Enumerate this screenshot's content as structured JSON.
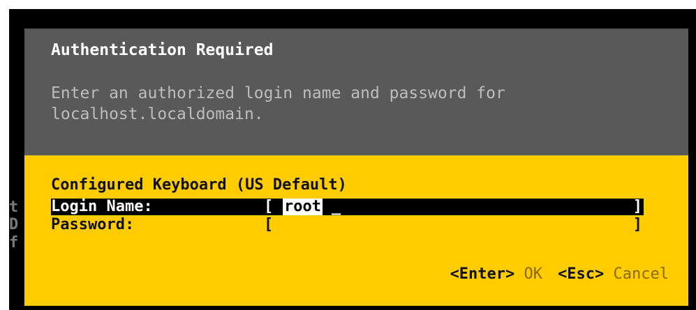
{
  "side_chars": [
    "t",
    "D",
    "f"
  ],
  "dialog": {
    "title": "Authentication Required",
    "message": "Enter an authorized login name and password for\nlocalhost.localdomain.",
    "keyboard_line": "Configured Keyboard (US Default)",
    "fields": {
      "login": {
        "label": "Login Name:",
        "value": "root",
        "cursor": "_",
        "bracket_open": "[",
        "bracket_close": "]"
      },
      "password": {
        "label": "Password:",
        "value": "",
        "bracket_open": "[",
        "bracket_close": "]"
      }
    },
    "actions": {
      "enter_key": "<Enter>",
      "enter_label": "OK",
      "esc_key": "<Esc>",
      "esc_label": "Cancel"
    }
  },
  "colors": {
    "dialog_background": "#ffcc00",
    "header_background": "#595959",
    "console_background": "#000000",
    "highlight_bar": "#000000"
  }
}
